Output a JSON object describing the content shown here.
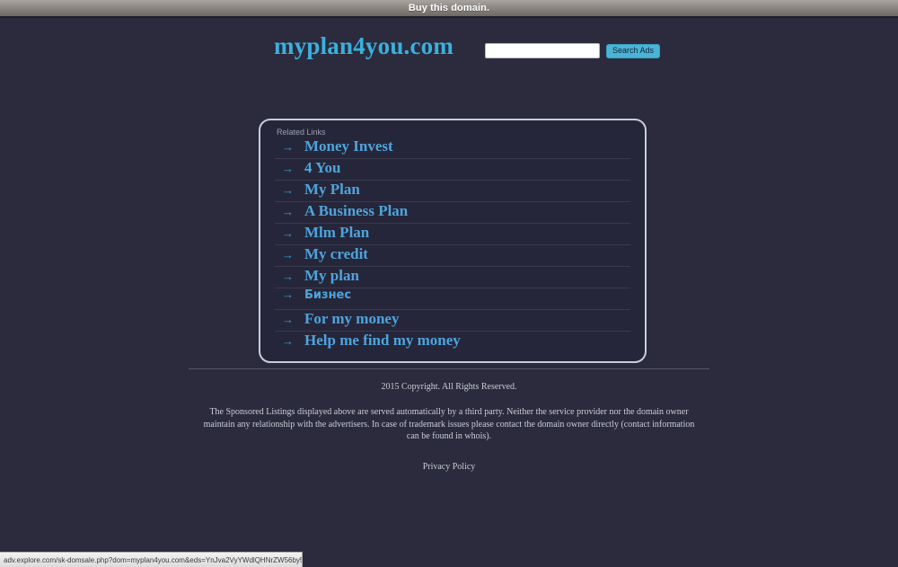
{
  "buybar": {
    "label": "Buy this domain."
  },
  "header": {
    "logo": "myplan4you.com",
    "search": {
      "value": "",
      "placeholder": "",
      "button_label": "Search Ads"
    }
  },
  "links_panel": {
    "label": "Related Links",
    "items": [
      {
        "arrow": "→",
        "label": "Money Invest",
        "script": "latin"
      },
      {
        "arrow": "→",
        "label": "4 You",
        "script": "latin"
      },
      {
        "arrow": "→",
        "label": "My Plan",
        "script": "latin"
      },
      {
        "arrow": "→",
        "label": "A Business Plan",
        "script": "latin"
      },
      {
        "arrow": "→",
        "label": "Mlm Plan",
        "script": "latin"
      },
      {
        "arrow": "→",
        "label": "My credit",
        "script": "latin"
      },
      {
        "arrow": "→",
        "label": "My plan",
        "script": "latin"
      },
      {
        "arrow": "→",
        "label": "Бизнес",
        "script": "cyrillic"
      },
      {
        "arrow": "→",
        "label": "For my money",
        "script": "latin"
      },
      {
        "arrow": "→",
        "label": "Help me find my money",
        "script": "latin"
      }
    ]
  },
  "footer": {
    "copyright": "2015 Copyright. All Rights Reserved.",
    "disclaimer": "The Sponsored Listings displayed above are served automatically by a third party. Neither the service provider nor the domain owner maintain any relationship with the advertisers. In case of trademark issues please contact the domain owner directly (contact information can be found in whois).",
    "privacy_label": "Privacy Policy"
  },
  "statusbar": {
    "url": "adv.explore.com/sk-domsale.php?dom=myplan4you.com&eds=YnJva2VyYWdlQHNrZW56by5jb20%3D"
  },
  "colors": {
    "background": "#2b2b3d",
    "link_blue": "#4ea4dc",
    "logo_blue": "#3bb0dd",
    "button_blue": "#49b4d6",
    "panel_border": "#c8cdd8",
    "footer_text": "#c9ccd6"
  }
}
